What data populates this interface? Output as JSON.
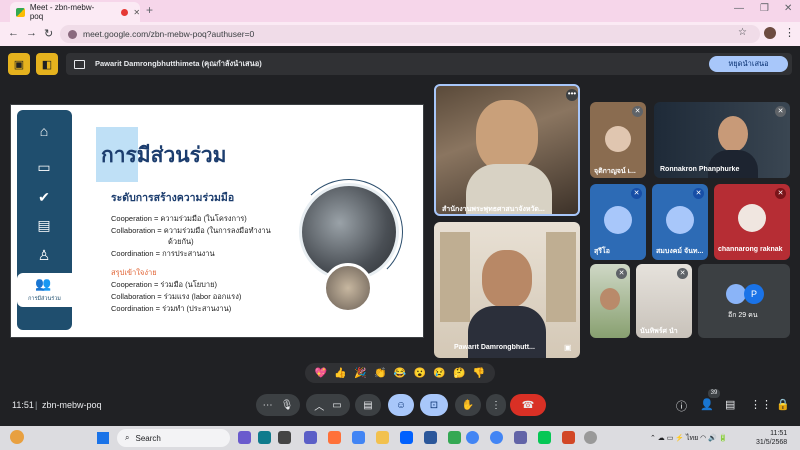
{
  "browser": {
    "tab_title": "Meet - zbn-mebw-poq",
    "new_tab": "+",
    "url": "meet.google.com/zbn-mebw-poq?authuser=0"
  },
  "presenting": {
    "text": "Pawarit Damrongbhutthimeta (คุณกำลังนำเสนอ)",
    "stop_label": "หยุดนำเสนอ"
  },
  "slide": {
    "title": "การมีส่วนร่วม",
    "subtitle": "ระดับการสร้างความร่วมมือ",
    "lines": [
      "Cooperation = ความร่วมมือ (ในโครงการ)",
      "Collaboration = ความร่วมมือ (ในการลงมือทำงาน",
      "ด้วยกัน)",
      "Coordination = การประสานงาน"
    ],
    "summary_heading": "สรุปเข้าใจง่าย",
    "summary_lines": [
      "Cooperation = ร่วมมือ (นโยบาย)",
      "Collaboration = ร่วมแรง (labor ออกแรง)",
      "Coordination = ร่วมทำ (ประสานงาน)"
    ],
    "sidebar_active_label": "การมีส่วนร่วม"
  },
  "participants": {
    "main_top": "สำนักงานพระพุทธศาสนาจังหวัด...",
    "main_bottom": "Pawarit Damrongbhutt...",
    "t1": "จุติกาญจน์ เ...",
    "t2": "Ronnakron Phanphurke",
    "t3": "สุรีโอ",
    "t4": "สมบงคม์ จันท...",
    "t5": "channarong raknak",
    "t6": "",
    "t7": "นันทิพร์ศ นำ",
    "others_label": "อีก 29 คน",
    "others_initial": "P"
  },
  "reactions": [
    "💖",
    "👍",
    "🎉",
    "👏",
    "😂",
    "😮",
    "😢",
    "🤔",
    "👎"
  ],
  "meeting": {
    "time": "11:51",
    "separator": "|",
    "code": "zbn-mebw-poq",
    "people_count": "39"
  },
  "taskbar": {
    "search_label": "Search",
    "lang": "ไทย",
    "time": "11:51",
    "date": "31/5/2568"
  },
  "colors": {
    "meet_bg": "#202124",
    "accent": "#a8c7fa",
    "end_call": "#d93025",
    "slide_navy": "#1f4e6e"
  }
}
